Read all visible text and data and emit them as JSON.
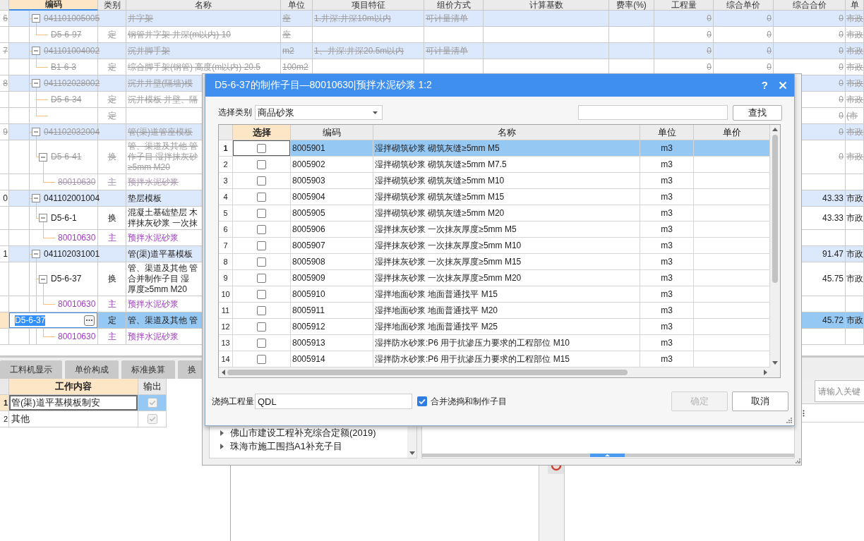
{
  "grid": {
    "columns": [
      {
        "label": "编码",
        "selected": true
      },
      {
        "label": "类别",
        "selected": false
      },
      {
        "label": "名称",
        "selected": false
      },
      {
        "label": "单位",
        "selected": false
      },
      {
        "label": "项目特征",
        "selected": false
      },
      {
        "label": "组价方式",
        "selected": false
      },
      {
        "label": "计算基数",
        "selected": false
      },
      {
        "label": "费率(%)",
        "selected": false
      },
      {
        "label": "工程量",
        "selected": false
      },
      {
        "label": "综合单价",
        "selected": false
      },
      {
        "label": "综合合价",
        "selected": false
      },
      {
        "label": "单",
        "selected": false
      }
    ],
    "rows": [
      {
        "kind": "bill",
        "number": "6",
        "code": "041101005005",
        "name": "井字架",
        "unit": "座",
        "feature": "1.井深:井深10m以内",
        "pricing": "可计量清单",
        "quantity": "0",
        "unit_price": "0",
        "total_price": "0",
        "specialty": "市政",
        "deleted": true,
        "selected": false,
        "editing": false,
        "expanded": true,
        "children": [
          {
            "kind": "norm",
            "code": "D5-6-97",
            "category": "定",
            "name": "钢管井字架 井深(m以内) 10",
            "unit": "座",
            "quantity": "0",
            "unit_price": "0",
            "total_price": "0",
            "specialty": "市政",
            "deleted": true,
            "selected": false,
            "editing": false
          }
        ]
      },
      {
        "kind": "bill",
        "number": "7",
        "code": "041101004002",
        "name": "沉井脚手架",
        "unit": "m2",
        "feature": "1、井深:井深20.5m以内",
        "pricing": "可计量清单",
        "quantity": "0",
        "unit_price": "0",
        "total_price": "0",
        "specialty": "市政",
        "deleted": true,
        "selected": false,
        "editing": false,
        "expanded": true,
        "children": [
          {
            "kind": "norm",
            "code": "B1-6-3",
            "category": "定",
            "name": "综合脚手架(钢管) 高度(m以内) 20.5",
            "unit": "100m2",
            "quantity": "0",
            "unit_price": "0",
            "total_price": "0",
            "specialty": "市政",
            "deleted": true,
            "selected": false,
            "editing": false
          }
        ]
      },
      {
        "kind": "bill",
        "number": "8",
        "code": "041102028002",
        "name": "沉井井壁(隔墙)模",
        "total_price": "0",
        "specialty": "市政",
        "deleted": true,
        "selected": false,
        "editing": false,
        "expanded": true,
        "children": [
          {
            "kind": "norm",
            "code": "D5-6-34",
            "category": "定",
            "name": "沉井模板 井壁、隔",
            "total_price": "0",
            "specialty": "市政",
            "deleted": true,
            "selected": false,
            "editing": false
          },
          {
            "kind": "norm",
            "category": "定",
            "total_price": "0",
            "specialty": "(市",
            "deleted": true,
            "selected": false,
            "editing": false
          }
        ]
      },
      {
        "kind": "bill",
        "number": "9",
        "code": "041102032004",
        "name": "管(渠)道管座模板",
        "total_price": "0",
        "specialty": "市政",
        "deleted": true,
        "selected": false,
        "editing": false,
        "expanded": true,
        "children": [
          {
            "kind": "norm",
            "code": "D5-6-41",
            "category": "换",
            "name_lines": [
              "管、渠道及其他 管",
              "作子目 湿拌抹灰砂",
              "≥5mm M20"
            ],
            "total_price": "0",
            "specialty": "市政",
            "deleted": true,
            "selected": false,
            "editing": false,
            "expanded": true,
            "children": [
              {
                "kind": "material",
                "code": "80010630",
                "category": "主",
                "name": "预拌水泥砂浆",
                "deleted": true,
                "selected": false,
                "editing": false
              }
            ]
          }
        ]
      },
      {
        "kind": "bill",
        "number": "0",
        "code": "041102001004",
        "name": "垫层模板",
        "total_price": "43.33",
        "specialty": "市政",
        "deleted": false,
        "selected": false,
        "editing": false,
        "expanded": true,
        "children": [
          {
            "kind": "norm",
            "code": "D5-6-1",
            "category": "换",
            "name_lines": [
              "混凝土基础垫层 木",
              "拌抹灰砂浆 一次抹"
            ],
            "total_price": "43.33",
            "specialty": "市政",
            "deleted": false,
            "selected": false,
            "editing": false,
            "expanded": true,
            "children": [
              {
                "kind": "material",
                "code": "80010630",
                "category": "主",
                "name": "预拌水泥砂浆",
                "deleted": false,
                "selected": false,
                "editing": false
              }
            ]
          }
        ]
      },
      {
        "kind": "bill",
        "number": "1",
        "code": "041102031001",
        "name": "管(渠)道平基模板",
        "total_price": "91.47",
        "specialty": "市政",
        "deleted": false,
        "selected": false,
        "editing": false,
        "expanded": true,
        "children": [
          {
            "kind": "norm",
            "code": "D5-6-37",
            "category": "换",
            "name_lines": [
              "管、渠道及其他 管",
              "合并制作子目 湿",
              "厚度≥5mm M20"
            ],
            "total_price": "45.75",
            "specialty": "市政",
            "deleted": false,
            "selected": false,
            "editing": false,
            "expanded": true,
            "children": [
              {
                "kind": "material",
                "code": "80010630",
                "category": "主",
                "name": "预拌水泥砂浆",
                "deleted": false,
                "selected": false,
                "editing": false
              }
            ]
          },
          {
            "kind": "norm",
            "code": "D5-6-37",
            "category": "定",
            "name": "管、渠道及其他 管",
            "total_price": "45.72",
            "specialty": "市政",
            "deleted": false,
            "selected": true,
            "editing": true,
            "children": [
              {
                "kind": "material",
                "code": "80010630",
                "category": "主",
                "name": "预拌水泥砂浆",
                "deleted": false,
                "selected": false,
                "editing": false
              }
            ]
          }
        ]
      }
    ]
  },
  "bottom_panel": {
    "tabs": [
      {
        "label": "工料机显示",
        "selected": false
      },
      {
        "label": "单价构成",
        "selected": false
      },
      {
        "label": "标准换算",
        "selected": false
      },
      {
        "label": "换",
        "selected": false
      }
    ],
    "work_table": {
      "columns": [
        {
          "label": "工作内容",
          "selected": true
        },
        {
          "label": "输出",
          "selected": false
        }
      ],
      "rows": [
        {
          "number": "1",
          "content": "管(渠)道平基模板制安",
          "output": true,
          "selected": true
        },
        {
          "number": "2",
          "content": "其他",
          "output": true,
          "selected": false
        }
      ]
    },
    "search": {
      "placeholder": "请输入关键"
    }
  },
  "back_window": {
    "tree": [
      {
        "label": "佛山市建设工程补充综合定额(2019)",
        "expanded": false
      },
      {
        "label": "珠海市施工围挡A1补充子目",
        "expanded": false
      }
    ]
  },
  "dialog": {
    "title": "D5-6-37的制作子目—80010630|预拌水泥砂浆 1:2",
    "help": "?",
    "category_label": "选择类别",
    "category": "商品砂浆",
    "search_button": "查找",
    "table": {
      "columns": [
        {
          "label": "选择",
          "selected": true
        },
        {
          "label": "编码",
          "selected": false
        },
        {
          "label": "名称",
          "selected": false
        },
        {
          "label": "单位",
          "selected": false
        },
        {
          "label": "单价",
          "selected": false
        }
      ],
      "rows": [
        {
          "number": "1",
          "code": "8005901",
          "name": "湿拌砌筑砂浆 砌筑灰缝≥5mm M5",
          "unit": "m3",
          "checked": false,
          "selected": true
        },
        {
          "number": "2",
          "code": "8005902",
          "name": "湿拌砌筑砂浆 砌筑灰缝≥5mm M7.5",
          "unit": "m3",
          "checked": false,
          "selected": false
        },
        {
          "number": "3",
          "code": "8005903",
          "name": "湿拌砌筑砂浆 砌筑灰缝≥5mm M10",
          "unit": "m3",
          "checked": false,
          "selected": false
        },
        {
          "number": "4",
          "code": "8005904",
          "name": "湿拌砌筑砂浆 砌筑灰缝≥5mm M15",
          "unit": "m3",
          "checked": false,
          "selected": false
        },
        {
          "number": "5",
          "code": "8005905",
          "name": "湿拌砌筑砂浆 砌筑灰缝≥5mm M20",
          "unit": "m3",
          "checked": false,
          "selected": false
        },
        {
          "number": "6",
          "code": "8005906",
          "name": "湿拌抹灰砂浆 一次抹灰厚度≥5mm M5",
          "unit": "m3",
          "checked": false,
          "selected": false
        },
        {
          "number": "7",
          "code": "8005907",
          "name": "湿拌抹灰砂浆 一次抹灰厚度≥5mm M10",
          "unit": "m3",
          "checked": false,
          "selected": false
        },
        {
          "number": "8",
          "code": "8005908",
          "name": "湿拌抹灰砂浆 一次抹灰厚度≥5mm M15",
          "unit": "m3",
          "checked": false,
          "selected": false
        },
        {
          "number": "9",
          "code": "8005909",
          "name": "湿拌抹灰砂浆 一次抹灰厚度≥5mm M20",
          "unit": "m3",
          "checked": false,
          "selected": false
        },
        {
          "number": "10",
          "code": "8005910",
          "name": "湿拌地面砂浆 地面普通找平 M15",
          "unit": "m3",
          "checked": false,
          "selected": false
        },
        {
          "number": "11",
          "code": "8005911",
          "name": "湿拌地面砂浆 地面普通找平 M20",
          "unit": "m3",
          "checked": false,
          "selected": false
        },
        {
          "number": "12",
          "code": "8005912",
          "name": "湿拌地面砂浆 地面普通找平 M25",
          "unit": "m3",
          "checked": false,
          "selected": false
        },
        {
          "number": "13",
          "code": "8005913",
          "name": "湿拌防水砂浆:P6 用于抗渗压力要求的工程部位 M10",
          "unit": "m3",
          "checked": false,
          "selected": false
        },
        {
          "number": "14",
          "code": "8005914",
          "name": "湿拌防水砂浆:P6 用于抗渗压力要求的工程部位 M15",
          "unit": "m3",
          "checked": false,
          "selected": false
        }
      ]
    },
    "quantity_label": "浇捣工程量",
    "quantity": "QDL",
    "merge": {
      "label": "合并浇捣和制作子目",
      "checked": true
    },
    "buttons": [
      {
        "label": "确定",
        "disabled": true
      },
      {
        "label": "取消",
        "disabled": false
      }
    ]
  }
}
